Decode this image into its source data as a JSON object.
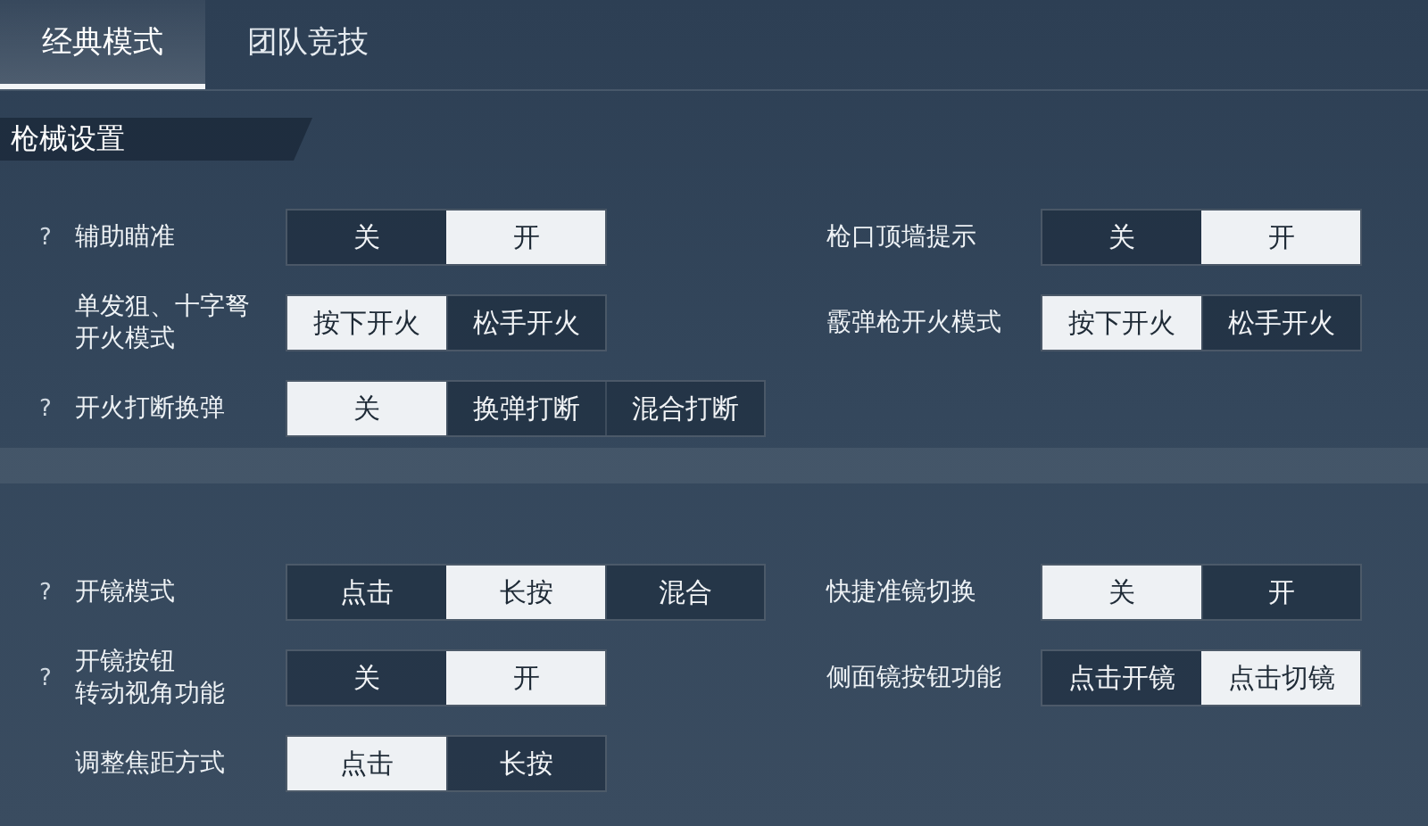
{
  "tabs": [
    {
      "label": "经典模式",
      "selected": true
    },
    {
      "label": "团队竞技",
      "selected": false
    }
  ],
  "sections": [
    {
      "title": "枪械设置",
      "rows": [
        [
          {
            "help": "?",
            "lines": [
              "辅助瞄准"
            ],
            "options": [
              {
                "label": "关",
                "selected": false
              },
              {
                "label": "开",
                "selected": true
              }
            ]
          },
          {
            "lines": [
              "枪口顶墙提示"
            ],
            "options": [
              {
                "label": "关",
                "selected": false
              },
              {
                "label": "开",
                "selected": true
              }
            ]
          }
        ],
        [
          {
            "lines": [
              "单发狙、十字弩",
              "开火模式"
            ],
            "options": [
              {
                "label": "按下开火",
                "selected": true
              },
              {
                "label": "松手开火",
                "selected": false
              }
            ]
          },
          {
            "lines": [
              "霰弹枪开火模式"
            ],
            "options": [
              {
                "label": "按下开火",
                "selected": true
              },
              {
                "label": "松手开火",
                "selected": false
              }
            ]
          }
        ],
        [
          {
            "help": "?",
            "lines": [
              "开火打断换弹"
            ],
            "options": [
              {
                "label": "关",
                "selected": true
              },
              {
                "label": "换弹打断",
                "selected": false
              },
              {
                "label": "混合打断",
                "selected": false
              }
            ]
          }
        ]
      ]
    },
    {
      "rows": [
        [
          {
            "help": "?",
            "lines": [
              "开镜模式"
            ],
            "options": [
              {
                "label": "点击",
                "selected": false
              },
              {
                "label": "长按",
                "selected": true
              },
              {
                "label": "混合",
                "selected": false
              }
            ]
          },
          {
            "lines": [
              "快捷准镜切换"
            ],
            "options": [
              {
                "label": "关",
                "selected": true
              },
              {
                "label": "开",
                "selected": false
              }
            ]
          }
        ],
        [
          {
            "help": "?",
            "lines": [
              "开镜按钮",
              "转动视角功能"
            ],
            "options": [
              {
                "label": "关",
                "selected": false
              },
              {
                "label": "开",
                "selected": true
              }
            ]
          },
          {
            "lines": [
              "侧面镜按钮功能"
            ],
            "options": [
              {
                "label": "点击开镜",
                "selected": false
              },
              {
                "label": "点击切镜",
                "selected": true
              }
            ]
          }
        ],
        [
          {
            "lines": [
              "调整焦距方式"
            ],
            "options": [
              {
                "label": "点击",
                "selected": true
              },
              {
                "label": "长按",
                "selected": false
              }
            ]
          }
        ]
      ]
    }
  ]
}
